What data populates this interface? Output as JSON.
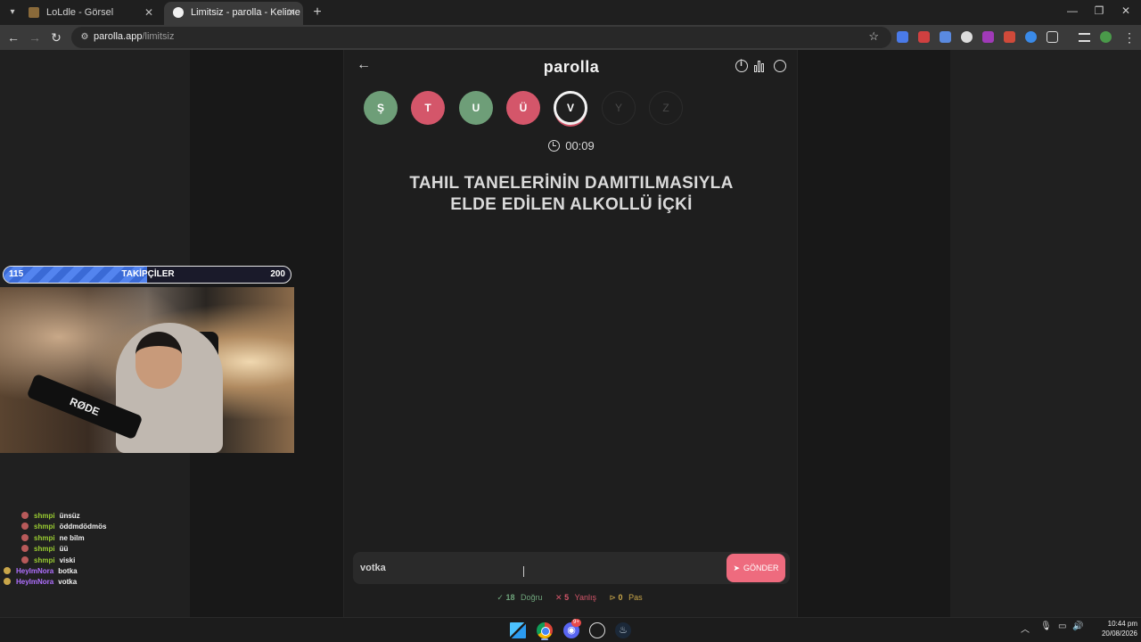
{
  "browser": {
    "tabs": [
      {
        "title": "LoLdle - Görsel",
        "active": false
      },
      {
        "title": "Limitsiz - parolla - Kelime oyunu",
        "active": true
      }
    ],
    "url_host": "parolla.app",
    "url_path": "/limitsiz"
  },
  "app": {
    "logo": "parolla",
    "letters": [
      {
        "char": "Ş",
        "state": "correct"
      },
      {
        "char": "T",
        "state": "wrong"
      },
      {
        "char": "U",
        "state": "correct"
      },
      {
        "char": "Ü",
        "state": "wrong"
      },
      {
        "char": "V",
        "state": "active"
      },
      {
        "char": "Y",
        "state": "pending"
      },
      {
        "char": "Z",
        "state": "pending"
      }
    ],
    "timer": "00:09",
    "question_line1": "TAHIL TANELERİNİN DAMITILMASIYLA",
    "question_line2": "ELDE EDİLEN ALKOLLÜ İÇKİ",
    "answer_value": "votka",
    "send_label": "GÖNDER",
    "score": {
      "correct_count": "18",
      "correct_label": "Doğru",
      "wrong_count": "5",
      "wrong_label": "Yanlış",
      "pass_count": "0",
      "pass_label": "Pas"
    },
    "colors": {
      "correct": "#6e9e78",
      "wrong": "#d4566a",
      "accent": "#ee6b7e"
    }
  },
  "overlay": {
    "follow_min": "115",
    "follow_label": "TAKİPÇİLER",
    "follow_max": "200",
    "follow_progress": 0.5,
    "mic_brand": "RØDE",
    "chat": [
      {
        "user": "shmpi",
        "msg": "ünsüz"
      },
      {
        "user": "shmpi",
        "msg": "öddmdödmös"
      },
      {
        "user": "shmpi",
        "msg": "ne bilm"
      },
      {
        "user": "shmpi",
        "msg": "üü"
      },
      {
        "user": "shmpi",
        "msg": "viski"
      },
      {
        "user": "HeyImNora",
        "msg": "botka"
      },
      {
        "user": "HeyImNora",
        "msg": "votka"
      }
    ]
  },
  "taskbar": {
    "discord_badge": "9+",
    "time": "10:44 pm",
    "date": "20/08/2026"
  }
}
